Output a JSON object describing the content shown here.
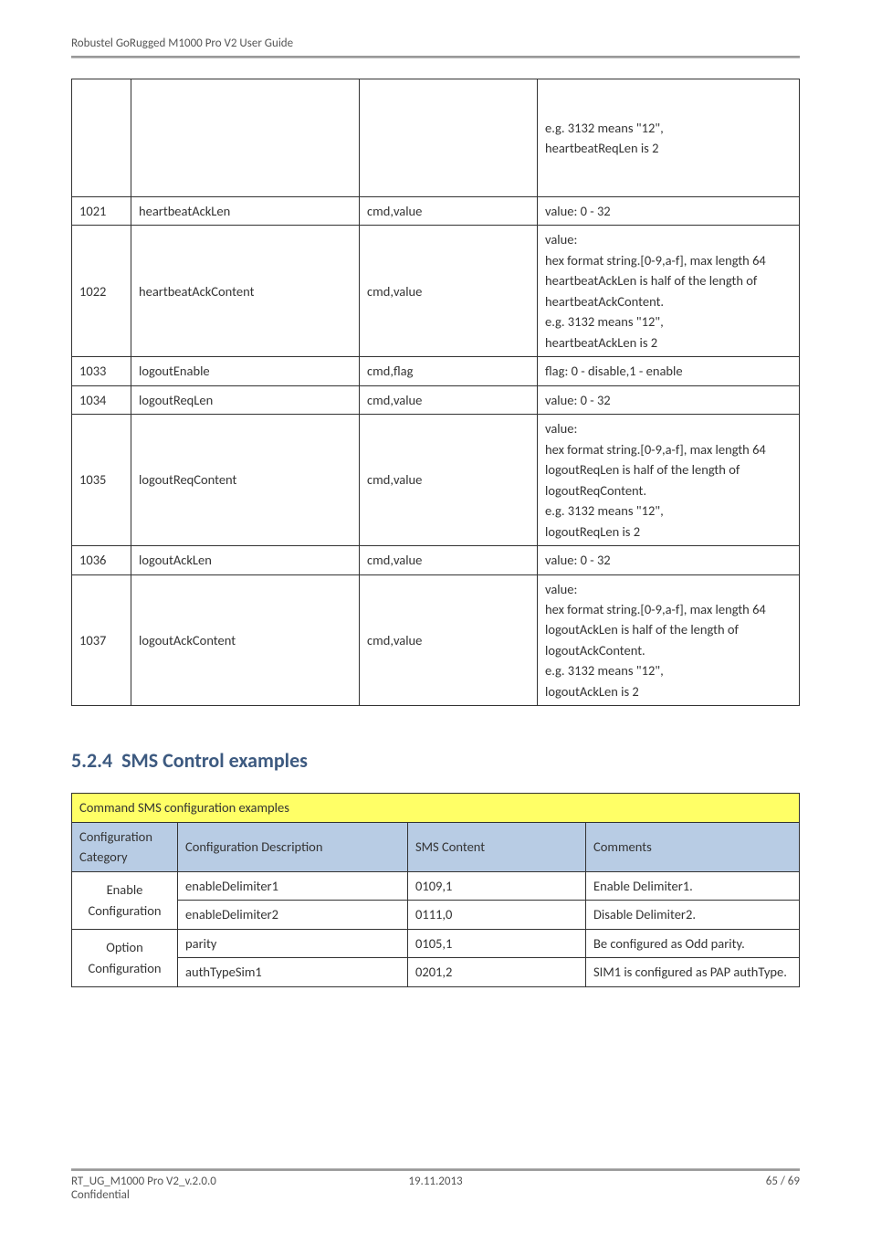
{
  "header": {
    "title": "Robustel GoRugged M1000 Pro V2 User Guide"
  },
  "table1": {
    "rows": [
      {
        "c1": "",
        "c2": "",
        "c3": "",
        "c4": "e.g. 3132 means \"12\",\nheartbeatReqLen is 2"
      },
      {
        "c1": "1021",
        "c2": "heartbeatAckLen",
        "c3": "cmd,value",
        "c4": "value: 0 - 32"
      },
      {
        "c1": "1022",
        "c2": "heartbeatAckContent",
        "c3": "cmd,value",
        "c4": "value:\nhex format string.[0-9,a-f],    max length 64\nheartbeatAckLen is half of the length of heartbeatAckContent.\ne.g. 3132 means \"12\",\nheartbeatAckLen is 2"
      },
      {
        "c1": "1033",
        "c2": "logoutEnable",
        "c3": "cmd,flag",
        "c4": "flag: 0 - disable,1 - enable"
      },
      {
        "c1": "1034",
        "c2": "logoutReqLen",
        "c3": "cmd,value",
        "c4": "value: 0 - 32"
      },
      {
        "c1": "1035",
        "c2": "logoutReqContent",
        "c3": "cmd,value",
        "c4": "value:\nhex format string.[0-9,a-f],    max length 64\nlogoutReqLen is half of the length of logoutReqContent.\ne.g. 3132 means \"12\",\nlogoutReqLen is 2"
      },
      {
        "c1": "1036",
        "c2": "logoutAckLen",
        "c3": "cmd,value",
        "c4": "value: 0 - 32"
      },
      {
        "c1": "1037",
        "c2": "logoutAckContent",
        "c3": "cmd,value",
        "c4": "value:\nhex format string.[0-9,a-f],    max length 64\nlogoutAckLen is half of the length of logoutAckContent.\ne.g. 3132 means \"12\",\nlogoutAckLen is 2"
      }
    ]
  },
  "section": {
    "number": "5.2.4",
    "title": "SMS Control examples"
  },
  "table2": {
    "title": "Command SMS configuration examples",
    "head": {
      "c1": "Configuration Category",
      "c2": "Configuration Description",
      "c3": "SMS Content",
      "c4": "Comments"
    },
    "rows": [
      {
        "cat": "Enable Configuration",
        "catRowspan": 2,
        "desc": "enableDelimiter1",
        "sms": "0109,1",
        "comments": "Enable Delimiter1."
      },
      {
        "desc": "enableDelimiter2",
        "sms": "0111,0",
        "comments": "Disable Delimiter2."
      },
      {
        "cat": "Option Configuration",
        "catRowspan": 2,
        "desc": "parity",
        "sms": "0105,1",
        "comments": "Be configured as Odd parity."
      },
      {
        "desc": "authTypeSim1",
        "sms": "0201,2",
        "comments": "SIM1 is configured as PAP authType."
      }
    ]
  },
  "footer": {
    "left": "RT_UG_M1000 Pro V2_v.2.0.0",
    "center": "19.11.2013",
    "right": "65 / 69",
    "confidential": "Confidential"
  }
}
